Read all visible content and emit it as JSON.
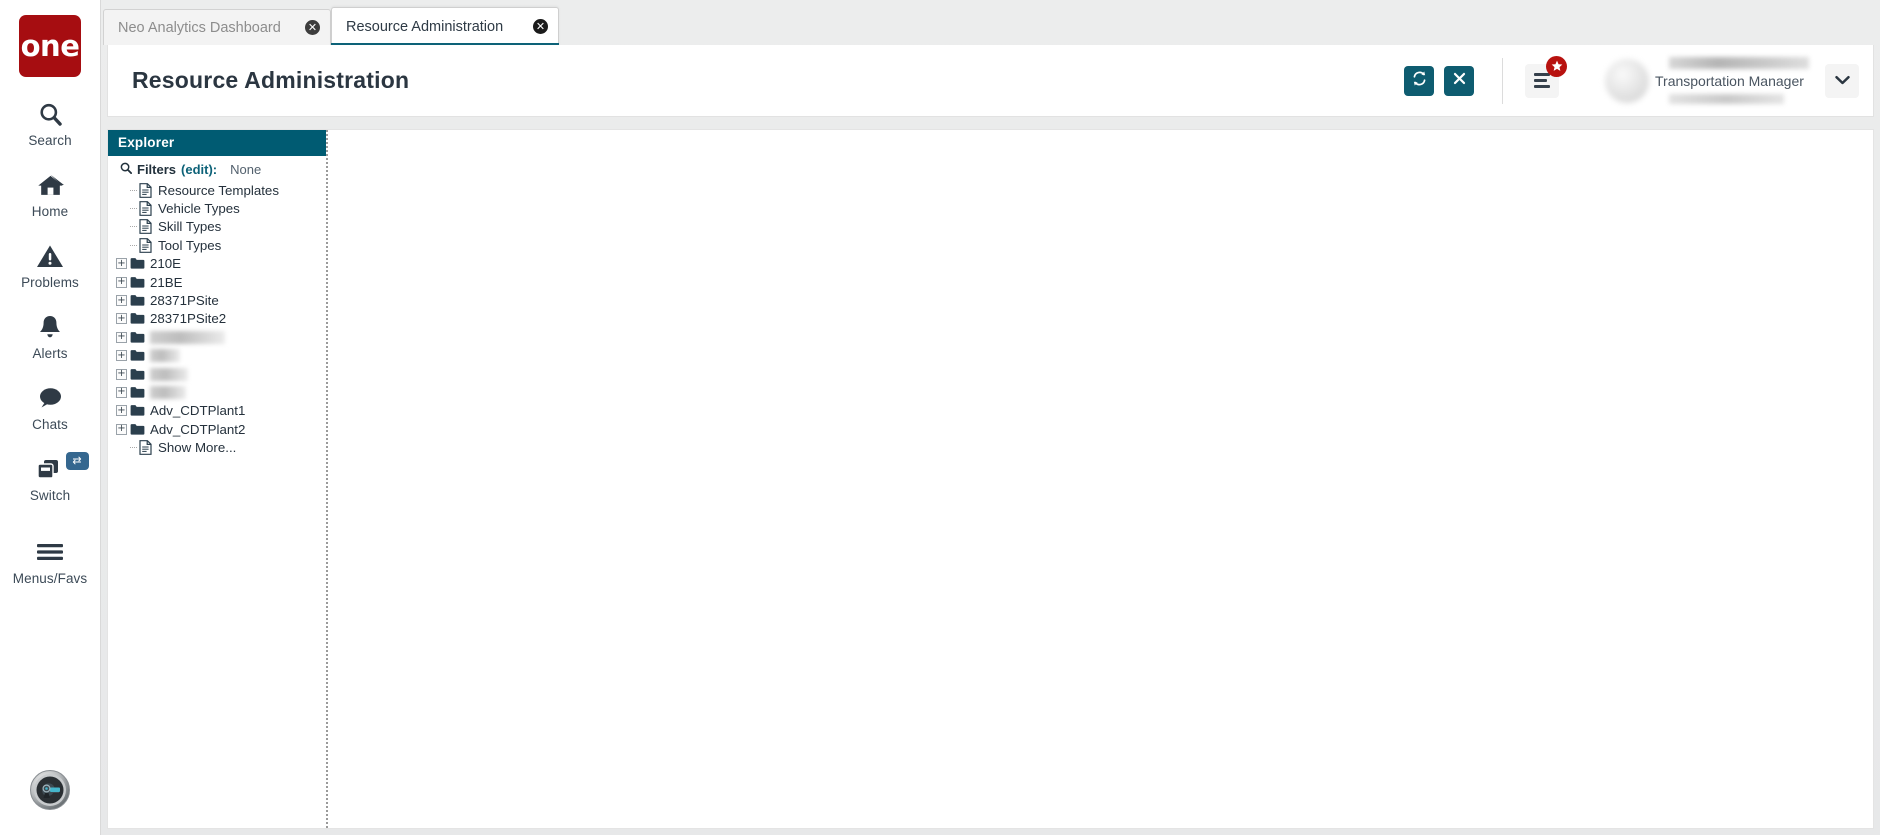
{
  "brand": {
    "logo_text": "one",
    "logo_color": "#a60d11"
  },
  "theme": {
    "teal": "#005b72",
    "teal_button": "#0e5c70",
    "badge_red": "#b8120f",
    "switch_blue": "#35678f"
  },
  "rail": {
    "items": [
      {
        "label": "Search",
        "icon": "search-icon"
      },
      {
        "label": "Home",
        "icon": "home-icon"
      },
      {
        "label": "Problems",
        "icon": "warning-triangle-icon"
      },
      {
        "label": "Alerts",
        "icon": "bell-icon"
      },
      {
        "label": "Chats",
        "icon": "chat-bubble-icon"
      },
      {
        "label": "Switch",
        "icon": "switch-windows-icon",
        "badge_icon": "exchange-arrows-icon"
      },
      {
        "label": "Menus/Favs",
        "icon": "hamburger-icon"
      }
    ],
    "assistant_icon": "ai-assistant-avatar-icon"
  },
  "tabs": [
    {
      "label": "Neo Analytics Dashboard",
      "active": false,
      "close_icon": "close-circle-icon"
    },
    {
      "label": "Resource Administration",
      "active": true,
      "close_icon": "close-circle-icon"
    }
  ],
  "header": {
    "title": "Resource Administration",
    "refresh_icon": "refresh-icon",
    "close_icon": "close-x-icon",
    "menu_icon": "menu-list-icon",
    "menu_badge_icon": "star-badge-icon",
    "user_role": "Transportation Manager",
    "caret_icon": "chevron-down-icon",
    "avatar_icon": "user-avatar"
  },
  "explorer": {
    "title": "Explorer",
    "search_icon": "search-icon",
    "filters_label": "Filters",
    "filters_edit": "(edit):",
    "filters_value": "None",
    "tree": [
      {
        "label": "Resource Templates",
        "type": "file",
        "expandable": false,
        "redacted": false
      },
      {
        "label": "Vehicle Types",
        "type": "file",
        "expandable": false,
        "redacted": false
      },
      {
        "label": "Skill Types",
        "type": "file",
        "expandable": false,
        "redacted": false
      },
      {
        "label": "Tool Types",
        "type": "file",
        "expandable": false,
        "redacted": false
      },
      {
        "label": "210E",
        "type": "folder",
        "expandable": true,
        "redacted": false
      },
      {
        "label": "21BE",
        "type": "folder",
        "expandable": true,
        "redacted": false
      },
      {
        "label": "28371PSite",
        "type": "folder",
        "expandable": true,
        "redacted": false
      },
      {
        "label": "28371PSite2",
        "type": "folder",
        "expandable": true,
        "redacted": false
      },
      {
        "label": "",
        "type": "folder",
        "expandable": true,
        "redacted": true,
        "redact_width": 75
      },
      {
        "label": "",
        "type": "folder",
        "expandable": true,
        "redacted": true,
        "redact_width": 30
      },
      {
        "label": "",
        "type": "folder",
        "expandable": true,
        "redacted": true,
        "redact_width": 38
      },
      {
        "label": "",
        "type": "folder",
        "expandable": true,
        "redacted": true,
        "redact_width": 36
      },
      {
        "label": "Adv_CDTPlant1",
        "type": "folder",
        "expandable": true,
        "redacted": false
      },
      {
        "label": "Adv_CDTPlant2",
        "type": "folder",
        "expandable": true,
        "redacted": false
      },
      {
        "label": "Show More...",
        "type": "file",
        "expandable": false,
        "redacted": false
      }
    ]
  }
}
